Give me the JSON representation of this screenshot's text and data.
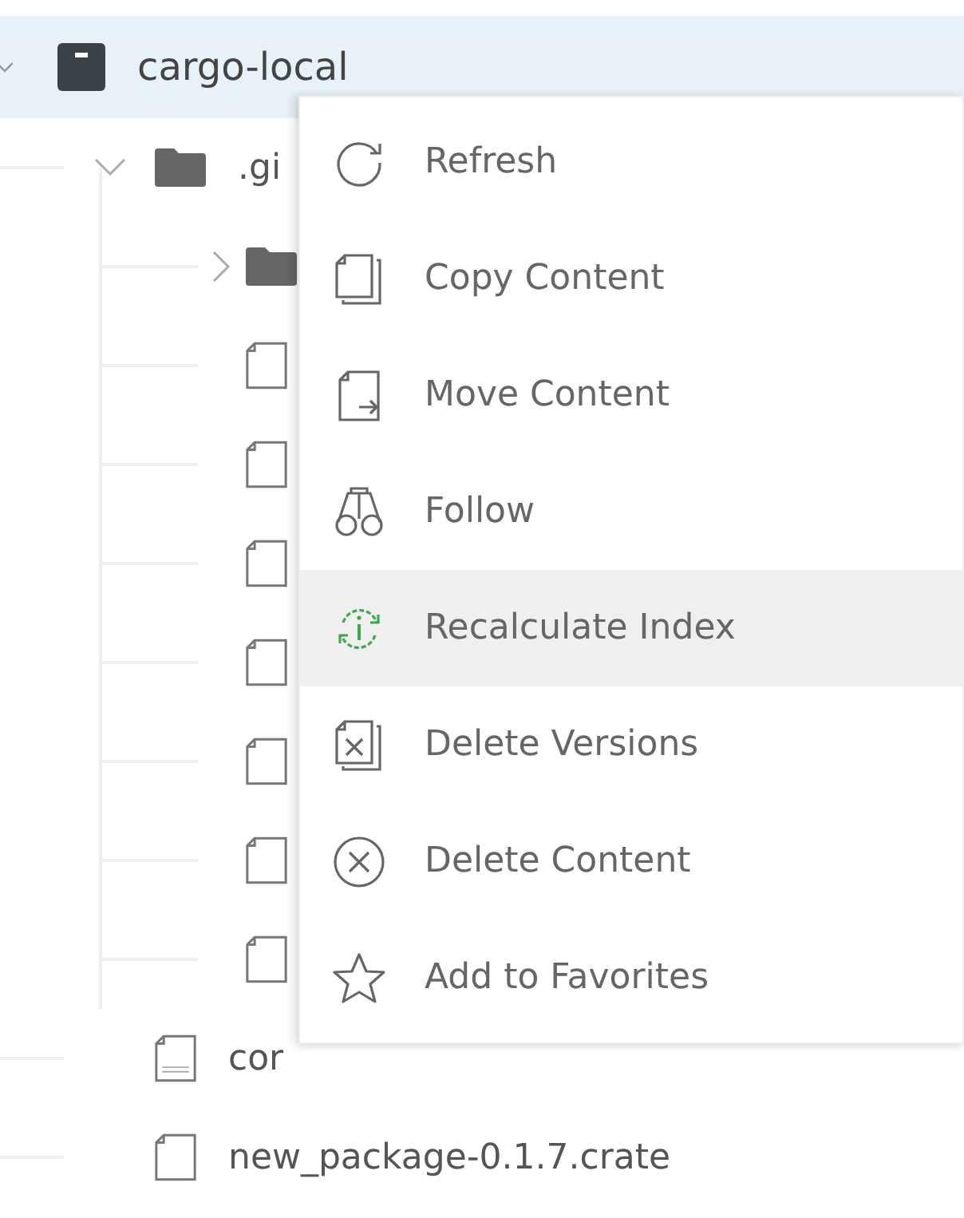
{
  "tree": {
    "label": "cargo-local",
    "expanded": true,
    "children": [
      {
        "kind": "folder",
        "label": ".gi",
        "expanded": true,
        "children": [
          {
            "kind": "folder",
            "expanded": false
          },
          {
            "kind": "file"
          },
          {
            "kind": "file"
          },
          {
            "kind": "file"
          },
          {
            "kind": "file"
          },
          {
            "kind": "file"
          },
          {
            "kind": "file"
          },
          {
            "kind": "file"
          }
        ]
      },
      {
        "kind": "json",
        "label": "cor"
      },
      {
        "kind": "file",
        "label": "new_package-0.1.7.crate"
      }
    ]
  },
  "context_menu": {
    "items": [
      {
        "kind": "refresh",
        "label": "Refresh",
        "highlighted": false
      },
      {
        "kind": "copy",
        "label": "Copy Content",
        "highlighted": false
      },
      {
        "kind": "move",
        "label": "Move Content",
        "highlighted": false
      },
      {
        "kind": "follow",
        "label": "Follow",
        "highlighted": false
      },
      {
        "kind": "recalculate",
        "label": "Recalculate Index",
        "highlighted": true
      },
      {
        "kind": "delete-versions",
        "label": "Delete Versions",
        "highlighted": false
      },
      {
        "kind": "delete",
        "label": "Delete Content",
        "highlighted": false
      },
      {
        "kind": "favorite",
        "label": "Add to Favorites",
        "highlighted": false
      }
    ]
  }
}
